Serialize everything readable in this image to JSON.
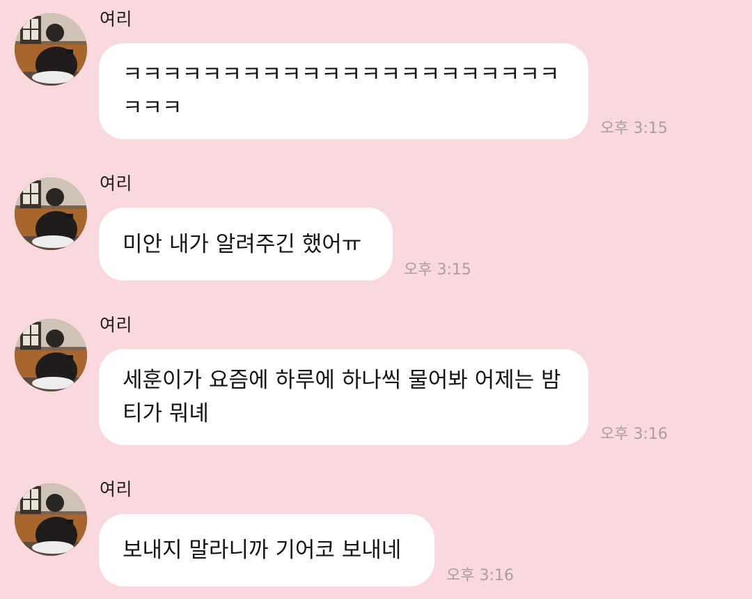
{
  "colors": {
    "background": "#f9d9de",
    "bubble": "#ffffff",
    "timestamp": "#a99ea0"
  },
  "messages": [
    {
      "sender": "여리",
      "avatar_icon": "profile-photo-avatar",
      "text": "ㅋㅋㅋㅋㅋㅋㅋㅋㅋㅋㅋㅋㅋㅋㅋㅋㅋㅋㅋㅋㅋㅋㅋㅋㅋ",
      "time": "오후 3:15"
    },
    {
      "sender": "여리",
      "avatar_icon": "profile-photo-avatar",
      "text": "미안 내가 알려주긴 했어ㅠ",
      "time": "오후 3:15"
    },
    {
      "sender": "여리",
      "avatar_icon": "profile-photo-avatar",
      "text": "세훈이가 요즘에 하루에 하나씩 물어봐 어제는 밤티가 뭐녜",
      "time": "오후 3:16"
    },
    {
      "sender": "여리",
      "avatar_icon": "profile-photo-avatar",
      "text": "보내지 말라니까 기어코 보내네",
      "time": "오후 3:16"
    }
  ]
}
